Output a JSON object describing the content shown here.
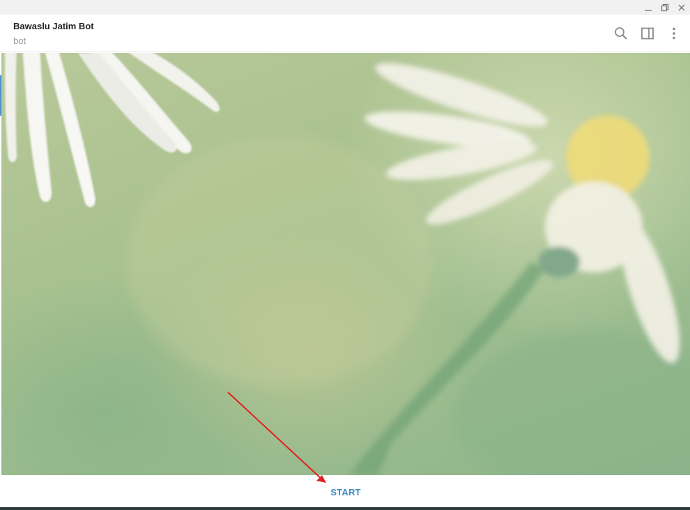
{
  "window": {
    "controls": [
      {
        "name": "minimize-icon"
      },
      {
        "name": "restore-icon"
      },
      {
        "name": "close-icon"
      }
    ]
  },
  "header": {
    "title": "Bawaslu Jatim Bot",
    "status": "bot",
    "icons": [
      "search-icon",
      "sidebar-toggle-icon",
      "more-vertical-icon"
    ]
  },
  "chat": {
    "wallpaper": "daisy-flowers-green-background"
  },
  "bottom": {
    "start_label": "START"
  },
  "annotation": {
    "arrow_color": "#e02020"
  },
  "colors": {
    "accent": "#3a8bc4",
    "titlebar": "#f1f1f1",
    "selection_bar": "#4a90d6"
  }
}
